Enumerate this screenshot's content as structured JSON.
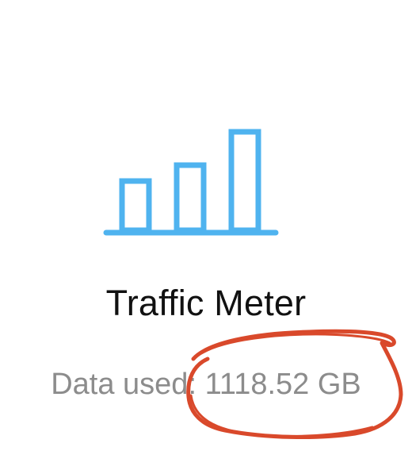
{
  "widget": {
    "icon": "bar-chart-icon",
    "title": "Traffic Meter",
    "data_used_label": "Data used",
    "data_used_separator": ": ",
    "data_used_value": "1118.52 GB"
  },
  "colors": {
    "icon": "#4fb3ef",
    "title": "#111111",
    "secondary_text": "#8c8c8c",
    "annotation": "#d9492b",
    "background": "#ffffff"
  },
  "annotation": {
    "type": "hand-drawn-circle",
    "target": "data_used_value"
  }
}
